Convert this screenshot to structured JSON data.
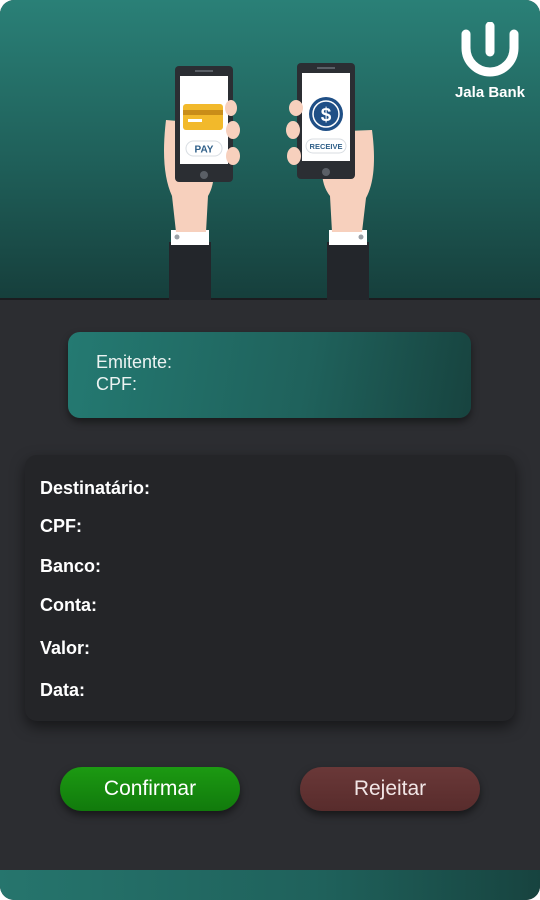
{
  "brand": {
    "name": "Jala Bank",
    "icon": "jala-bank-logo-icon",
    "accent": "#2a8077"
  },
  "illustration": {
    "pay_label": "PAY",
    "receive_label": "RECEIVE",
    "currency_symbol": "$"
  },
  "sender": {
    "emitente_label": "Emitente:",
    "cpf_label": "CPF:"
  },
  "recipient": {
    "destinatario_label": "Destinatário:",
    "cpf_label": "CPF:",
    "banco_label": "Banco:",
    "conta_label": "Conta:",
    "valor_label": "Valor:",
    "data_label": "Data:"
  },
  "actions": {
    "confirm_label": "Confirmar",
    "reject_label": "Rejeitar",
    "confirm_color": "#1c9a12",
    "reject_color": "#6a3838"
  }
}
